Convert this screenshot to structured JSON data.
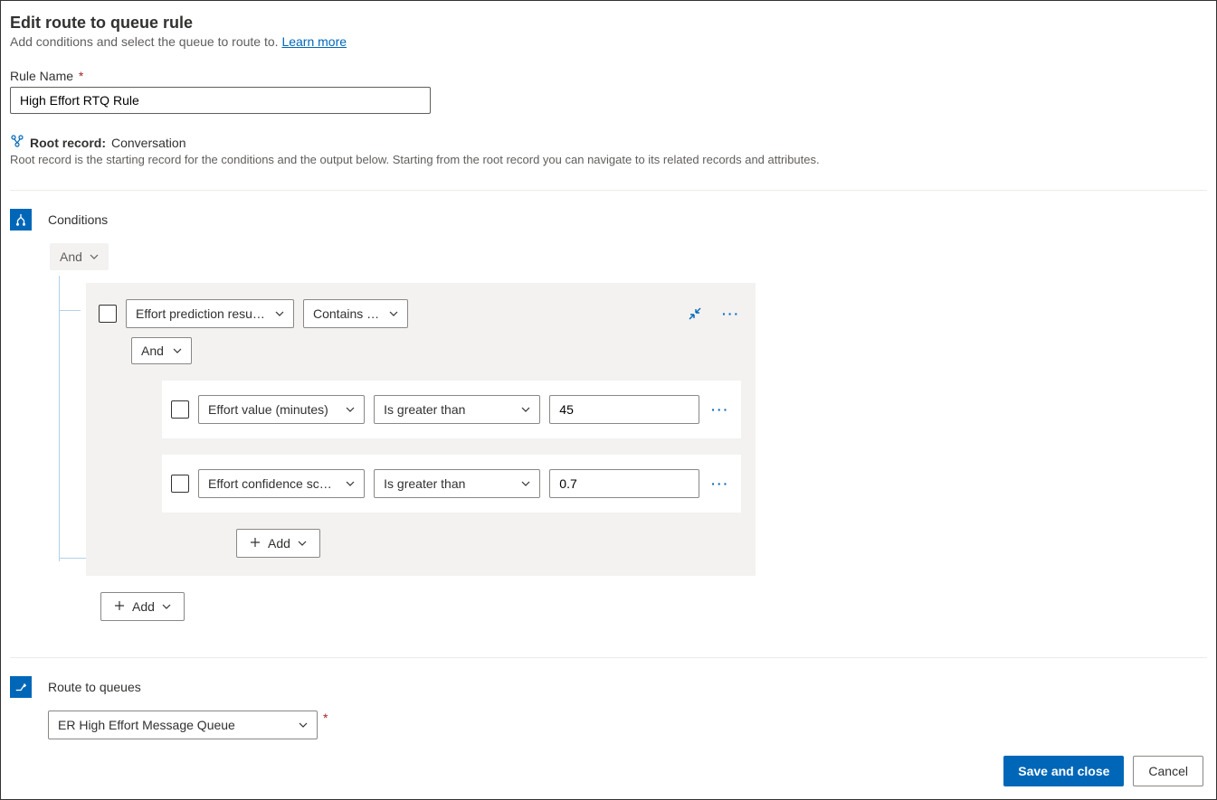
{
  "header": {
    "title": "Edit route to queue rule",
    "subtitle_text": "Add conditions and select the queue to route to. ",
    "learn_more": "Learn more"
  },
  "rule_name": {
    "label": "Rule Name",
    "value": "High Effort RTQ Rule"
  },
  "root_record": {
    "label": "Root record:",
    "value": "Conversation",
    "description": "Root record is the starting record for the conditions and the output below. Starting from the root record you can navigate to its related records and attributes."
  },
  "conditions": {
    "section_title": "Conditions",
    "outer_group": "And",
    "entity_field": "Effort prediction result...",
    "entity_operator": "Contains data",
    "inner_group": "And",
    "rows": [
      {
        "field": "Effort value (minutes)",
        "operator": "Is greater than",
        "value": "45"
      },
      {
        "field": "Effort confidence score",
        "operator": "Is greater than",
        "value": "0.7"
      }
    ],
    "add_label": "Add"
  },
  "route": {
    "section_title": "Route to queues",
    "queue": "ER High Effort Message Queue"
  },
  "footer": {
    "save": "Save and close",
    "cancel": "Cancel"
  }
}
